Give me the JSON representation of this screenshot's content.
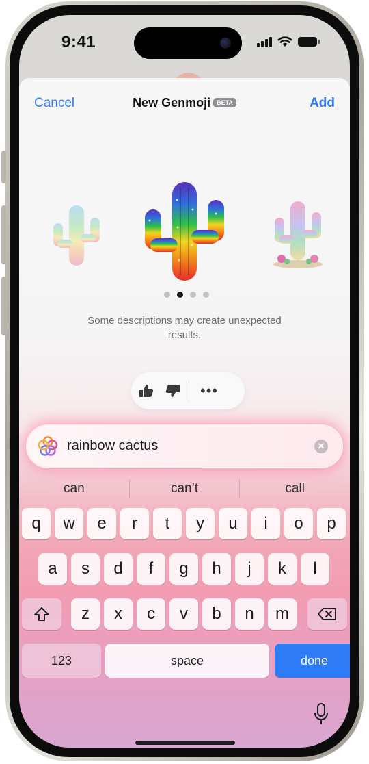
{
  "status_bar": {
    "time": "9:41"
  },
  "sheet": {
    "cancel_label": "Cancel",
    "title": "New Genmoji",
    "beta_badge": "BETA",
    "add_label": "Add",
    "carousel": {
      "pages": 4,
      "active_page": 2,
      "variants": [
        "faded rainbow cactus",
        "rainbow cactus",
        "cactus with flowers"
      ]
    },
    "note": "Some descriptions may create unexpected results."
  },
  "input": {
    "value": "rainbow cactus"
  },
  "suggestions": [
    "can",
    "can’t",
    "call"
  ],
  "keyboard": {
    "row1": [
      "q",
      "w",
      "e",
      "r",
      "t",
      "y",
      "u",
      "i",
      "o",
      "p"
    ],
    "row2": [
      "a",
      "s",
      "d",
      "f",
      "g",
      "h",
      "j",
      "k",
      "l"
    ],
    "row3": [
      "z",
      "x",
      "c",
      "v",
      "b",
      "n",
      "m"
    ],
    "numbers_label": "123",
    "space_label": "space",
    "done_label": "done"
  },
  "colors": {
    "accent": "#2f7cf6",
    "done_key": "#2f7cf6"
  }
}
